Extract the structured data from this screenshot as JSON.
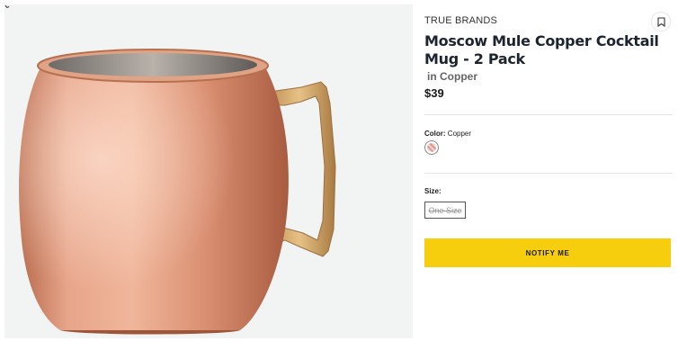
{
  "product": {
    "brand": "TRUE BRANDS",
    "title": "Moscow Mule Copper Cocktail Mug - 2 Pack",
    "variant": "in Copper",
    "price": "$39"
  },
  "color": {
    "label": "Color:",
    "value": "Copper",
    "swatch_icon": "diagonal-stripe-swatch",
    "swatch_color": "#d99a8f"
  },
  "size": {
    "label": "Size:",
    "options": [
      "One Size"
    ],
    "selected": "One Size",
    "available": false
  },
  "actions": {
    "notify_label": "NOTIFY ME",
    "notify_color": "#f7ce0d",
    "bookmark_icon": "bookmark-icon"
  },
  "image": {
    "alt": "copper-mug-photo",
    "background": "#f2f3f3"
  }
}
